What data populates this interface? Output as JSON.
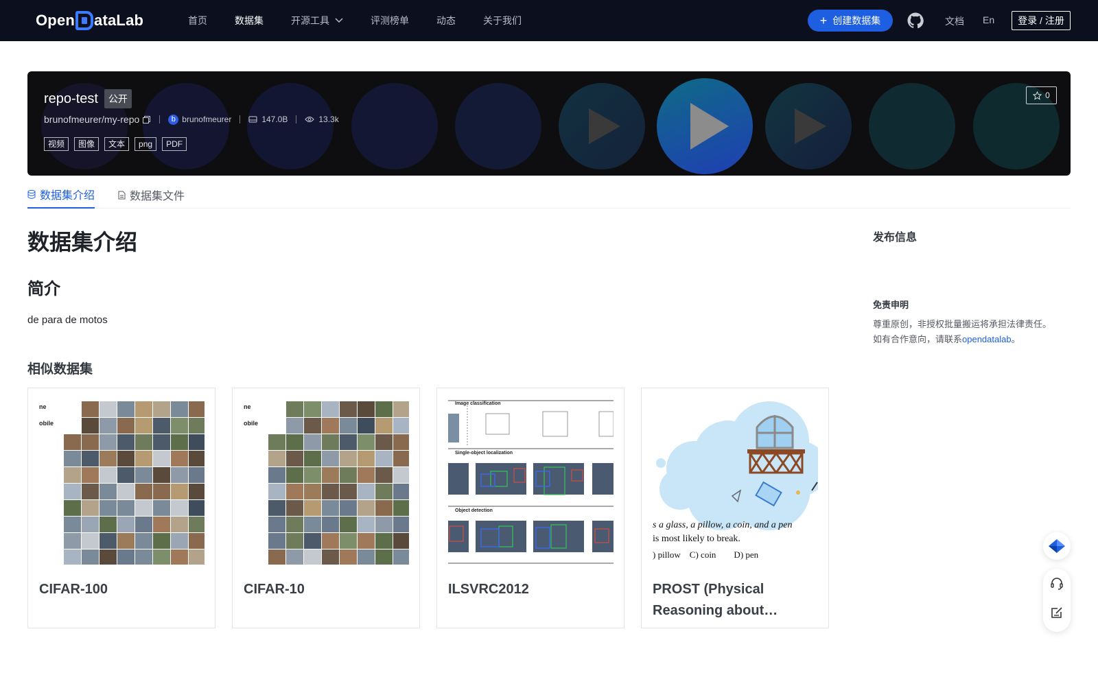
{
  "header": {
    "logo_text_before": "Open",
    "logo_text_after": "ataLab",
    "nav": [
      {
        "label": "首页"
      },
      {
        "label": "数据集"
      },
      {
        "label": "开源工具"
      },
      {
        "label": "评测榜单"
      },
      {
        "label": "动态"
      },
      {
        "label": "关于我们"
      }
    ],
    "create_button": "创建数据集",
    "docs": "文档",
    "lang": "En",
    "login": "登录 / 注册"
  },
  "repo": {
    "title": "repo-test",
    "visibility": "公开",
    "path": "brunofmeurer/my-repo",
    "owner_initial": "b",
    "owner": "brunofmeurer",
    "size": "147.0B",
    "views": "13.3k",
    "tags": [
      "视频",
      "图像",
      "文本",
      "png",
      "PDF"
    ],
    "stars": "0"
  },
  "tabs": [
    {
      "label": "数据集介绍",
      "icon": "database-icon"
    },
    {
      "label": "数据集文件",
      "icon": "file-icon"
    }
  ],
  "content": {
    "heading": "数据集介绍",
    "section_title": "简介",
    "description": "de para de motos",
    "similar_title": "相似数据集"
  },
  "similar": [
    {
      "title": "CIFAR-100",
      "thumb": "image-grid"
    },
    {
      "title": "CIFAR-10",
      "thumb": "image-grid"
    },
    {
      "title": "ILSVRC2012",
      "thumb": "detection-figure"
    },
    {
      "title": "PROST (Physical Reasoning about…",
      "thumb": "thought-cloud"
    }
  ],
  "sidebar": {
    "publish_info": "发布信息",
    "disclaimer_title": "免责申明",
    "disclaimer_line1": "尊重原创，非授权批量搬运将承担法律责任。",
    "disclaimer_line2_prefix": "如有合作意向，请联系",
    "disclaimer_link": "opendatalab",
    "disclaimer_line2_suffix": "。"
  },
  "figure_text": {
    "cifar_partial_1": "ne",
    "cifar_partial_2": "obile",
    "ilsvrc_section1": "Image classification",
    "ilsvrc_section2": "Single-object localization",
    "ilsvrc_section3": "Object detection",
    "prost_line1": "s a glass, a pillow, a coin, and a pen",
    "prost_line2": "is most likely to break.",
    "prost_line3": ") pillow    C) coin        D) pen"
  },
  "colors": {
    "brand": "#1d5fe0",
    "topbar": "#0b0f1e",
    "banner": "#0e0e10"
  }
}
